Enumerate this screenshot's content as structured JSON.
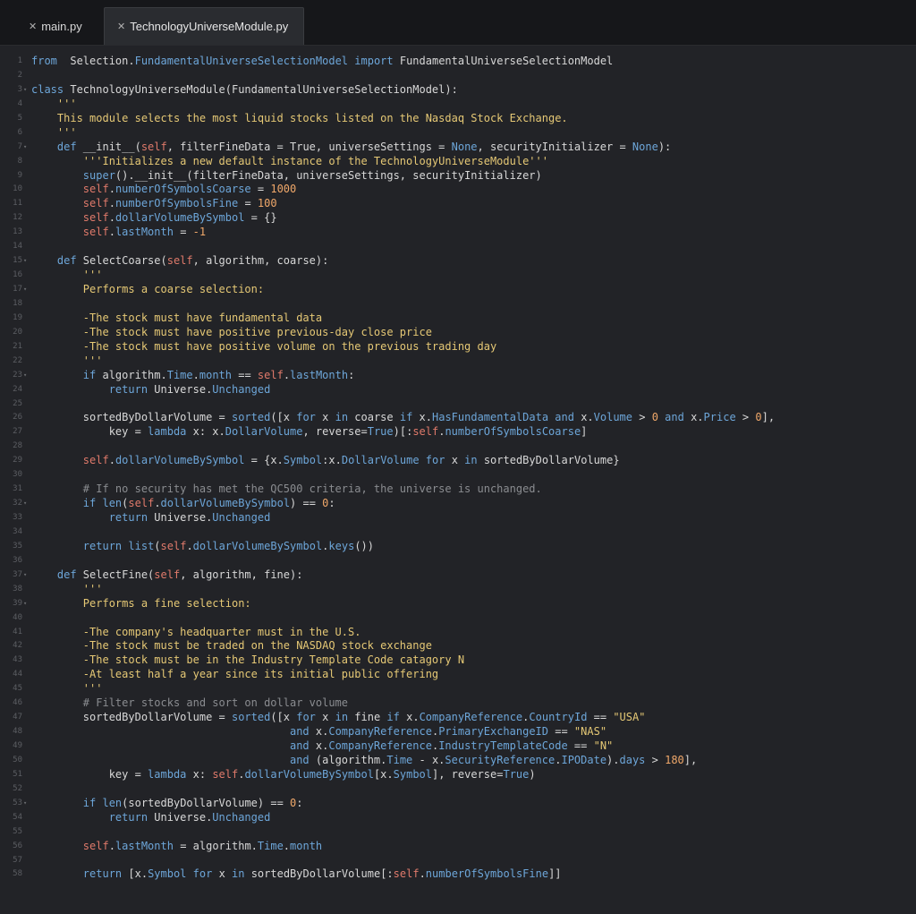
{
  "tabs": [
    {
      "close_glyph": "✕",
      "label": "main.py"
    },
    {
      "close_glyph": "✕",
      "label": "TechnologyUniverseModule.py"
    }
  ],
  "lines": [
    [
      [
        "kw",
        "from"
      ],
      [
        "",
        "  Selection."
      ],
      [
        "at",
        "FundamentalUniverseSelectionModel"
      ],
      [
        "",
        " "
      ],
      [
        "kw",
        "import"
      ],
      [
        "",
        " FundamentalUniverseSelectionModel"
      ]
    ],
    [],
    [
      [
        "kw",
        "class"
      ],
      [
        "",
        " TechnologyUniverseModule(FundamentalUniverseSelectionModel):"
      ]
    ],
    [
      [
        "st",
        "    '''"
      ]
    ],
    [
      [
        "st",
        "    This module selects the most liquid stocks listed on the Nasdaq Stock Exchange."
      ]
    ],
    [
      [
        "st",
        "    '''"
      ]
    ],
    [
      [
        "kw",
        "    def"
      ],
      [
        "",
        " __init__("
      ],
      [
        "sf",
        "self"
      ],
      [
        "",
        ", filterFineData = True, universeSettings = "
      ],
      [
        "kw",
        "None"
      ],
      [
        "",
        ", securityInitializer = "
      ],
      [
        "kw",
        "None"
      ],
      [
        "",
        "):"
      ]
    ],
    [
      [
        "st",
        "        '''Initializes a new default instance of the TechnologyUniverseModule'''"
      ]
    ],
    [
      [
        "kw",
        "        super"
      ],
      [
        "",
        "().__init__(filterFineData, universeSettings, securityInitializer)"
      ]
    ],
    [
      [
        "sf",
        "        self"
      ],
      [
        "",
        "."
      ],
      [
        "at",
        "numberOfSymbolsCoarse"
      ],
      [
        "",
        " = "
      ],
      [
        "nm",
        "1000"
      ]
    ],
    [
      [
        "sf",
        "        self"
      ],
      [
        "",
        "."
      ],
      [
        "at",
        "numberOfSymbolsFine"
      ],
      [
        "",
        " = "
      ],
      [
        "nm",
        "100"
      ]
    ],
    [
      [
        "sf",
        "        self"
      ],
      [
        "",
        "."
      ],
      [
        "at",
        "dollarVolumeBySymbol"
      ],
      [
        "",
        " = {}"
      ]
    ],
    [
      [
        "sf",
        "        self"
      ],
      [
        "",
        "."
      ],
      [
        "at",
        "lastMonth"
      ],
      [
        "",
        " = "
      ],
      [
        "nm",
        "-1"
      ]
    ],
    [],
    [
      [
        "kw",
        "    def"
      ],
      [
        "",
        " SelectCoarse("
      ],
      [
        "sf",
        "self"
      ],
      [
        "",
        ", algorithm, coarse):"
      ]
    ],
    [
      [
        "st",
        "        '''"
      ]
    ],
    [
      [
        "st",
        "        Performs a coarse selection:"
      ]
    ],
    [],
    [
      [
        "st",
        "        -The stock must have fundamental data"
      ]
    ],
    [
      [
        "st",
        "        -The stock must have positive previous-day close price"
      ]
    ],
    [
      [
        "st",
        "        -The stock must have positive volume on the previous trading day"
      ]
    ],
    [
      [
        "st",
        "        '''"
      ]
    ],
    [
      [
        "kw",
        "        if"
      ],
      [
        "",
        " algorithm."
      ],
      [
        "at",
        "Time"
      ],
      [
        "",
        "."
      ],
      [
        "at",
        "month"
      ],
      [
        "",
        " == "
      ],
      [
        "sf",
        "self"
      ],
      [
        "",
        "."
      ],
      [
        "at",
        "lastMonth"
      ],
      [
        "",
        ":"
      ]
    ],
    [
      [
        "kw",
        "            return"
      ],
      [
        "",
        " Universe."
      ],
      [
        "at",
        "Unchanged"
      ]
    ],
    [],
    [
      [
        "",
        "        sortedByDollarVolume = "
      ],
      [
        "kw",
        "sorted"
      ],
      [
        "",
        "([x "
      ],
      [
        "kw",
        "for"
      ],
      [
        "",
        " x "
      ],
      [
        "kw",
        "in"
      ],
      [
        "",
        " coarse "
      ],
      [
        "kw",
        "if"
      ],
      [
        "",
        " x."
      ],
      [
        "at",
        "HasFundamentalData"
      ],
      [
        "",
        " "
      ],
      [
        "kw",
        "and"
      ],
      [
        "",
        " x."
      ],
      [
        "at",
        "Volume"
      ],
      [
        "",
        " > "
      ],
      [
        "nm",
        "0"
      ],
      [
        "",
        " "
      ],
      [
        "kw",
        "and"
      ],
      [
        "",
        " x."
      ],
      [
        "at",
        "Price"
      ],
      [
        "",
        " > "
      ],
      [
        "nm",
        "0"
      ],
      [
        "",
        "],"
      ]
    ],
    [
      [
        "",
        "            key = "
      ],
      [
        "kw",
        "lambda"
      ],
      [
        "",
        " x: x."
      ],
      [
        "at",
        "DollarVolume"
      ],
      [
        "",
        ", reverse="
      ],
      [
        "kw",
        "True"
      ],
      [
        "",
        ")[:"
      ],
      [
        "sf",
        "self"
      ],
      [
        "",
        "."
      ],
      [
        "at",
        "numberOfSymbolsCoarse"
      ],
      [
        "",
        "]"
      ]
    ],
    [],
    [
      [
        "sf",
        "        self"
      ],
      [
        "",
        "."
      ],
      [
        "at",
        "dollarVolumeBySymbol"
      ],
      [
        "",
        " = {x."
      ],
      [
        "at",
        "Symbol"
      ],
      [
        "",
        ":x."
      ],
      [
        "at",
        "DollarVolume"
      ],
      [
        "",
        " "
      ],
      [
        "kw",
        "for"
      ],
      [
        "",
        " x "
      ],
      [
        "kw",
        "in"
      ],
      [
        "",
        " sortedByDollarVolume}"
      ]
    ],
    [],
    [
      [
        "cm",
        "        # If no security has met the QC500 criteria, the universe is unchanged."
      ]
    ],
    [
      [
        "kw",
        "        if"
      ],
      [
        "",
        " "
      ],
      [
        "kw",
        "len"
      ],
      [
        "",
        "("
      ],
      [
        "sf",
        "self"
      ],
      [
        "",
        "."
      ],
      [
        "at",
        "dollarVolumeBySymbol"
      ],
      [
        "",
        ") == "
      ],
      [
        "nm",
        "0"
      ],
      [
        "",
        ":"
      ]
    ],
    [
      [
        "kw",
        "            return"
      ],
      [
        "",
        " Universe."
      ],
      [
        "at",
        "Unchanged"
      ]
    ],
    [],
    [
      [
        "kw",
        "        return"
      ],
      [
        "",
        " "
      ],
      [
        "kw",
        "list"
      ],
      [
        "",
        "("
      ],
      [
        "sf",
        "self"
      ],
      [
        "",
        "."
      ],
      [
        "at",
        "dollarVolumeBySymbol"
      ],
      [
        "",
        "."
      ],
      [
        "at",
        "keys"
      ],
      [
        "",
        "())"
      ]
    ],
    [],
    [
      [
        "kw",
        "    def"
      ],
      [
        "",
        " SelectFine("
      ],
      [
        "sf",
        "self"
      ],
      [
        "",
        ", algorithm, fine):"
      ]
    ],
    [
      [
        "st",
        "        '''"
      ]
    ],
    [
      [
        "st",
        "        Performs a fine selection:"
      ]
    ],
    [],
    [
      [
        "st",
        "        -The company's headquarter must in the U.S."
      ]
    ],
    [
      [
        "st",
        "        -The stock must be traded on the NASDAQ stock exchange"
      ]
    ],
    [
      [
        "st",
        "        -The stock must be in the Industry Template Code catagory N"
      ]
    ],
    [
      [
        "st",
        "        -At least half a year since its initial public offering"
      ]
    ],
    [
      [
        "st",
        "        '''"
      ]
    ],
    [
      [
        "cm",
        "        # Filter stocks and sort on dollar volume"
      ]
    ],
    [
      [
        "",
        "        sortedByDollarVolume = "
      ],
      [
        "kw",
        "sorted"
      ],
      [
        "",
        "([x "
      ],
      [
        "kw",
        "for"
      ],
      [
        "",
        " x "
      ],
      [
        "kw",
        "in"
      ],
      [
        "",
        " fine "
      ],
      [
        "kw",
        "if"
      ],
      [
        "",
        " x."
      ],
      [
        "at",
        "CompanyReference"
      ],
      [
        "",
        "."
      ],
      [
        "at",
        "CountryId"
      ],
      [
        "",
        " == "
      ],
      [
        "st",
        "\"USA\""
      ]
    ],
    [
      [
        "kw",
        "                                        and"
      ],
      [
        "",
        " x."
      ],
      [
        "at",
        "CompanyReference"
      ],
      [
        "",
        "."
      ],
      [
        "at",
        "PrimaryExchangeID"
      ],
      [
        "",
        " == "
      ],
      [
        "st",
        "\"NAS\""
      ]
    ],
    [
      [
        "kw",
        "                                        and"
      ],
      [
        "",
        " x."
      ],
      [
        "at",
        "CompanyReference"
      ],
      [
        "",
        "."
      ],
      [
        "at",
        "IndustryTemplateCode"
      ],
      [
        "",
        " == "
      ],
      [
        "st",
        "\"N\""
      ]
    ],
    [
      [
        "kw",
        "                                        and"
      ],
      [
        "",
        " (algorithm."
      ],
      [
        "at",
        "Time"
      ],
      [
        "",
        " - x."
      ],
      [
        "at",
        "SecurityReference"
      ],
      [
        "",
        "."
      ],
      [
        "at",
        "IPODate"
      ],
      [
        "",
        ")."
      ],
      [
        "at",
        "days"
      ],
      [
        "",
        " > "
      ],
      [
        "nm",
        "180"
      ],
      [
        "",
        "],"
      ]
    ],
    [
      [
        "",
        "            key = "
      ],
      [
        "kw",
        "lambda"
      ],
      [
        "",
        " x: "
      ],
      [
        "sf",
        "self"
      ],
      [
        "",
        "."
      ],
      [
        "at",
        "dollarVolumeBySymbol"
      ],
      [
        "",
        "[x."
      ],
      [
        "at",
        "Symbol"
      ],
      [
        "",
        "], reverse="
      ],
      [
        "kw",
        "True"
      ],
      [
        "",
        ")"
      ]
    ],
    [],
    [
      [
        "kw",
        "        if"
      ],
      [
        "",
        " "
      ],
      [
        "kw",
        "len"
      ],
      [
        "",
        "(sortedByDollarVolume) == "
      ],
      [
        "nm",
        "0"
      ],
      [
        "",
        ":"
      ]
    ],
    [
      [
        "kw",
        "            return"
      ],
      [
        "",
        " Universe."
      ],
      [
        "at",
        "Unchanged"
      ]
    ],
    [],
    [
      [
        "sf",
        "        self"
      ],
      [
        "",
        "."
      ],
      [
        "at",
        "lastMonth"
      ],
      [
        "",
        " = algorithm."
      ],
      [
        "at",
        "Time"
      ],
      [
        "",
        "."
      ],
      [
        "at",
        "month"
      ]
    ],
    [],
    [
      [
        "kw",
        "        return"
      ],
      [
        "",
        " [x."
      ],
      [
        "at",
        "Symbol"
      ],
      [
        "",
        " "
      ],
      [
        "kw",
        "for"
      ],
      [
        "",
        " x "
      ],
      [
        "kw",
        "in"
      ],
      [
        "",
        " sortedByDollarVolume[:"
      ],
      [
        "sf",
        "self"
      ],
      [
        "",
        "."
      ],
      [
        "at",
        "numberOfSymbolsFine"
      ],
      [
        "",
        "]]"
      ]
    ]
  ],
  "fold_lines": [
    3,
    7,
    15,
    17,
    23,
    32,
    37,
    39,
    53
  ]
}
